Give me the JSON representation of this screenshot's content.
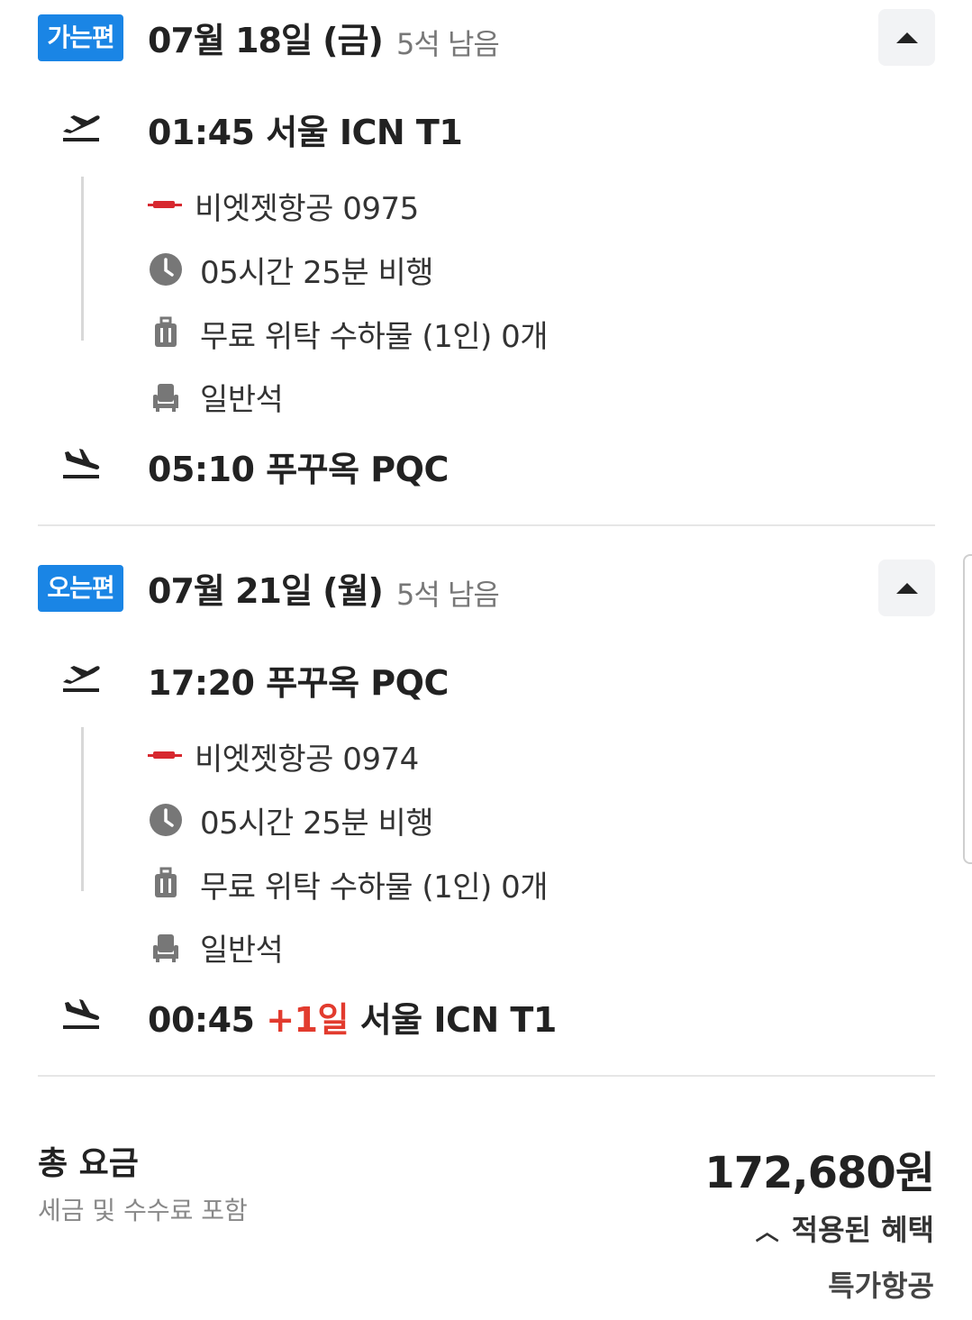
{
  "outbound": {
    "badge": "가는편",
    "date": "07월 18일 (금)",
    "seats_left": "5석 남음",
    "departure": "01:45 서울 ICN T1",
    "airline": "비엣젯항공 0975",
    "duration": "05시간 25분 비행",
    "baggage": "무료 위탁 수하물 (1인) 0개",
    "cabin": "일반석",
    "arrival": "05:10 푸꾸옥 PQC"
  },
  "return": {
    "badge": "오는편",
    "date": "07월 21일 (월)",
    "seats_left": "5석 남음",
    "departure": "17:20 푸꾸옥 PQC",
    "airline": "비엣젯항공 0974",
    "duration": "05시간 25분 비행",
    "baggage": "무료 위탁 수하물 (1인) 0개",
    "cabin": "일반석",
    "arrival_time": "00:45",
    "arrival_plus_day": "+1일",
    "arrival_place": "서울 ICN T1"
  },
  "total": {
    "label": "총 요금",
    "sub": "세금 및 수수료 포함",
    "price": "172,680원",
    "benefit_toggle": "적용된 혜택",
    "benefit_item": "특가항공"
  },
  "colors": {
    "badge": "#1a85e5",
    "plus_day": "#e23b2e",
    "airline_logo": "#d7282f"
  }
}
